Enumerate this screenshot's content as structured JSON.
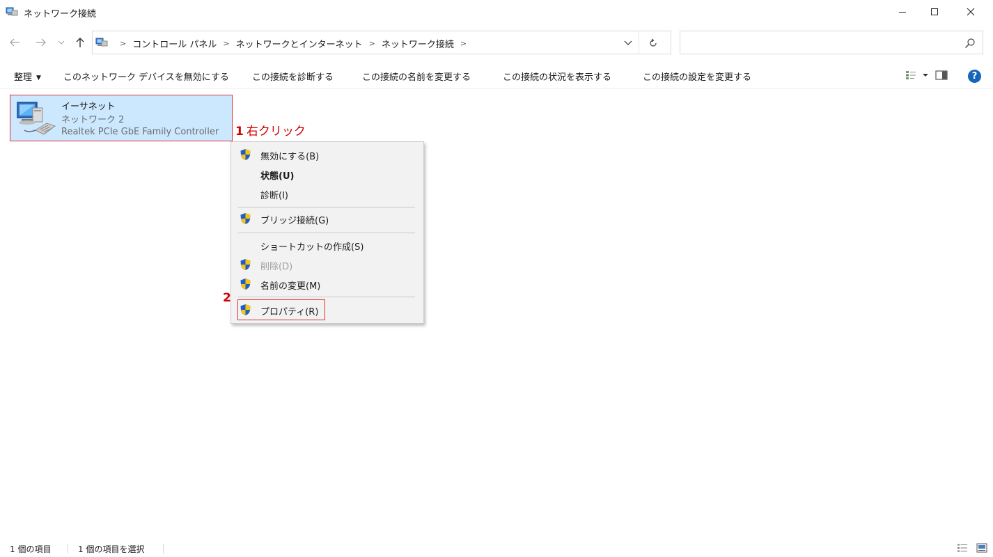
{
  "window": {
    "title": "ネットワーク接続",
    "title_icon": "network-connections-icon"
  },
  "nav": {
    "back_icon": "back-arrow-icon",
    "forward_icon": "forward-arrow-icon",
    "recent_icon": "chevron-down-icon",
    "up_icon": "up-arrow-icon",
    "breadcrumbs": [
      "コントロール パネル",
      "ネットワークとインターネット",
      "ネットワーク接続"
    ],
    "search_placeholder": ""
  },
  "commandbar": {
    "organize": "整理",
    "items": [
      "このネットワーク デバイスを無効にする",
      "この接続を診断する",
      "この接続の名前を変更する",
      "この接続の状況を表示する",
      "この接続の設定を変更する"
    ],
    "help": "?"
  },
  "network_item": {
    "name": "イーサネット",
    "network": "ネットワーク 2",
    "adapter": "Realtek PCIe GbE Family Controller",
    "selected": true
  },
  "annotations": {
    "step1_number": "1",
    "step1_text": "右クリック",
    "step2_number": "2"
  },
  "context_menu": {
    "items": [
      {
        "label": "無効にする(B)",
        "shield": true,
        "bold": false,
        "disabled": false
      },
      {
        "label": "状態(U)",
        "shield": false,
        "bold": true,
        "disabled": false
      },
      {
        "label": "診断(I)",
        "shield": false,
        "bold": false,
        "disabled": false
      },
      {
        "label": "ブリッジ接続(G)",
        "shield": true,
        "bold": false,
        "disabled": false
      },
      {
        "label": "ショートカットの作成(S)",
        "shield": false,
        "bold": false,
        "disabled": false
      },
      {
        "label": "削除(D)",
        "shield": true,
        "bold": false,
        "disabled": true
      },
      {
        "label": "名前の変更(M)",
        "shield": true,
        "bold": false,
        "disabled": false
      },
      {
        "label": "プロパティ(R)",
        "shield": true,
        "bold": false,
        "disabled": false
      }
    ]
  },
  "statusbar": {
    "item_count": "1 個の項目",
    "selected_count": "1 個の項目を選択"
  },
  "colors": {
    "selection_bg": "#cce8ff",
    "annotation_red": "#d00000",
    "help_blue": "#1466b8"
  }
}
